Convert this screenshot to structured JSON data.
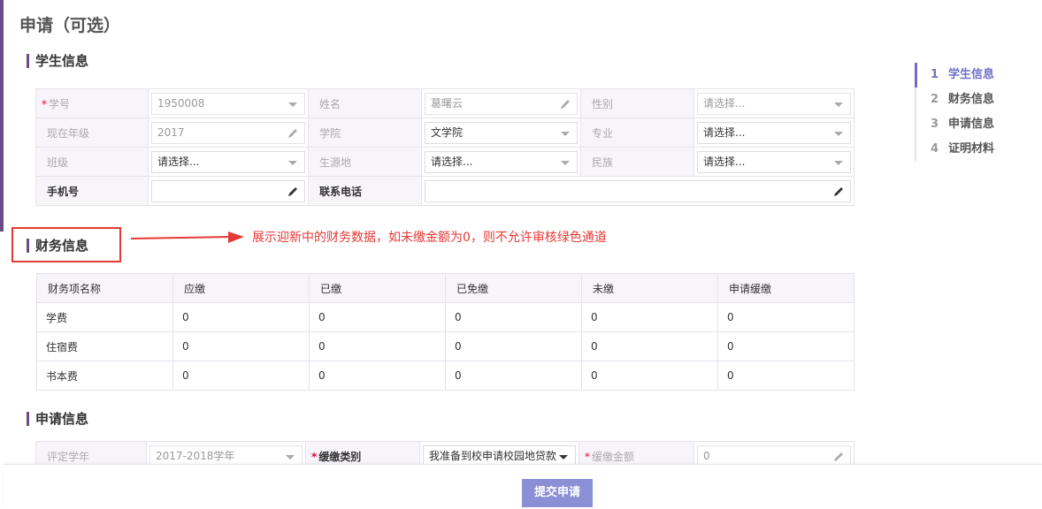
{
  "page": {
    "title": "申请（可选）"
  },
  "sections": {
    "student": "学生信息",
    "finance": "财务信息",
    "application": "申请信息"
  },
  "student_form": {
    "student_id": {
      "label": "学号",
      "value": "1950008"
    },
    "name": {
      "label": "姓名",
      "value": "葛曙云"
    },
    "gender": {
      "label": "性别",
      "value": "请选择..."
    },
    "grade": {
      "label": "现在年级",
      "value": "2017"
    },
    "college": {
      "label": "学院",
      "value": "文学院"
    },
    "major": {
      "label": "专业",
      "value": "请选择..."
    },
    "class": {
      "label": "班级",
      "value": "请选择..."
    },
    "origin": {
      "label": "生源地",
      "value": "请选择..."
    },
    "ethnicity": {
      "label": "民族",
      "value": "请选择..."
    },
    "mobile": {
      "label": "手机号",
      "value": ""
    },
    "phone": {
      "label": "联系电话",
      "value": ""
    }
  },
  "annotation": {
    "text": "展示迎新中的财务数据，如未缴金额为0，则不允许审核绿色通道"
  },
  "finance_table": {
    "headers": [
      "财务项名称",
      "应缴",
      "已缴",
      "已免缴",
      "未缴",
      "申请缓缴"
    ],
    "rows": [
      [
        "学费",
        "0",
        "0",
        "0",
        "0",
        "0"
      ],
      [
        "住宿费",
        "0",
        "0",
        "0",
        "0",
        "0"
      ],
      [
        "书本费",
        "0",
        "0",
        "0",
        "0",
        "0"
      ]
    ]
  },
  "application_form": {
    "year": {
      "label": "评定学年",
      "value": "2017-2018学年"
    },
    "category": {
      "label": "缓缴类别",
      "value": "我准备到校申请校园地贷款"
    },
    "amount": {
      "label": "缓缴金额",
      "value": "0"
    }
  },
  "steps": [
    {
      "num": "1",
      "label": "学生信息"
    },
    {
      "num": "2",
      "label": "财务信息"
    },
    {
      "num": "3",
      "label": "申请信息"
    },
    {
      "num": "4",
      "label": "证明材料"
    }
  ],
  "footer": {
    "submit_label": "提交申请"
  },
  "colors": {
    "accent": "#6b4a8a",
    "step_active": "#6f6fc7",
    "button": "#8a8fd6",
    "annotation": "#e53935"
  }
}
